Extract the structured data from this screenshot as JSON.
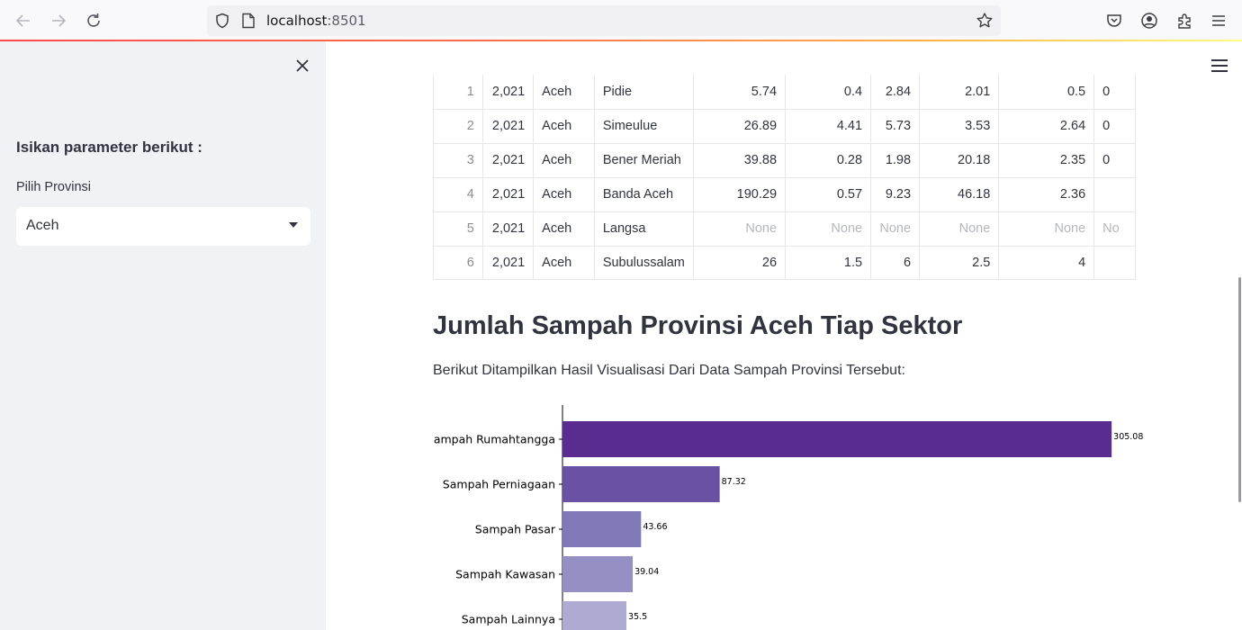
{
  "browser": {
    "url_host": "localhost",
    "url_port": ":8501"
  },
  "sidebar": {
    "heading": "Isikan parameter berikut :",
    "select_label": "Pilih Provinsi",
    "select_value": "Aceh"
  },
  "table": {
    "rows": [
      [
        "1",
        "2,021",
        "Aceh",
        "Pidie",
        "5.74",
        "0.4",
        "2.84",
        "2.01",
        "0.5",
        "0"
      ],
      [
        "2",
        "2,021",
        "Aceh",
        "Simeulue",
        "26.89",
        "4.41",
        "5.73",
        "3.53",
        "2.64",
        "0"
      ],
      [
        "3",
        "2,021",
        "Aceh",
        "Bener Meriah",
        "39.88",
        "0.28",
        "1.98",
        "20.18",
        "2.35",
        "0"
      ],
      [
        "4",
        "2,021",
        "Aceh",
        "Banda Aceh",
        "190.29",
        "0.57",
        "9.23",
        "46.18",
        "2.36",
        ""
      ],
      [
        "5",
        "2,021",
        "Aceh",
        "Langsa",
        "None",
        "None",
        "None",
        "None",
        "None",
        "No"
      ],
      [
        "6",
        "2,021",
        "Aceh",
        "Subulussalam",
        "26",
        "1.5",
        "6",
        "2.5",
        "4",
        ""
      ]
    ]
  },
  "main": {
    "title": "Jumlah Sampah Provinsi Aceh Tiap Sektor",
    "subtitle": "Berikut Ditampilkan Hasil Visualisasi Dari Data Sampah Provinsi Tersebut:"
  },
  "chart_data": {
    "type": "bar",
    "orientation": "horizontal",
    "categories": [
      "Sampah Rumahtangga",
      "Sampah Perniagaan",
      "Sampah Pasar",
      "Sampah Kawasan",
      "Sampah Lainnya"
    ],
    "values": [
      305.08,
      87.32,
      43.66,
      39.04,
      35.5
    ],
    "value_labels": [
      "305.08",
      "87.32",
      "43.66",
      "39.04",
      "35.5"
    ],
    "colors": [
      "#582d8f",
      "#6a51a3",
      "#8079b7",
      "#9590c4",
      "#aeaad2"
    ],
    "xlim": [
      0,
      320
    ],
    "grid": false
  }
}
